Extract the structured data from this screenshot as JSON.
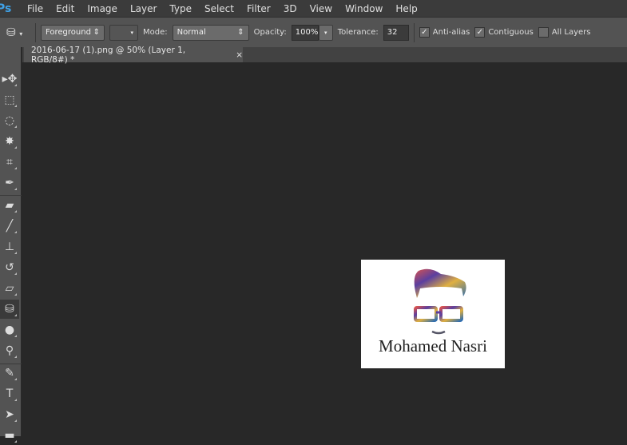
{
  "app": {
    "logo": "Ps"
  },
  "menu": [
    "File",
    "Edit",
    "Image",
    "Layer",
    "Type",
    "Select",
    "Filter",
    "3D",
    "View",
    "Window",
    "Help"
  ],
  "options": {
    "fill_source": "Foreground",
    "mode_label": "Mode:",
    "mode_value": "Normal",
    "opacity_label": "Opacity:",
    "opacity_value": "100%",
    "tolerance_label": "Tolerance:",
    "tolerance_value": "32",
    "anti_alias_label": "Anti-alias",
    "anti_alias_checked": true,
    "contiguous_label": "Contiguous",
    "contiguous_checked": true,
    "all_layers_label": "All Layers",
    "all_layers_checked": false
  },
  "document": {
    "tab_title": "2016-06-17 (1).png @ 50% (Layer 1, RGB/8#) *",
    "close": "×",
    "caption": "Mohamed Nasri"
  },
  "tools": [
    {
      "name": "move",
      "glyph": "▸✥"
    },
    {
      "name": "marquee",
      "glyph": "⬚"
    },
    {
      "name": "lasso",
      "glyph": "◌"
    },
    {
      "name": "magic-wand",
      "glyph": "✸"
    },
    {
      "name": "crop",
      "glyph": "⌗"
    },
    {
      "name": "eyedropper",
      "glyph": "✒"
    },
    {
      "name": "healing",
      "glyph": "▰"
    },
    {
      "name": "brush",
      "glyph": "╱"
    },
    {
      "name": "stamp",
      "glyph": "⊥"
    },
    {
      "name": "history-brush",
      "glyph": "↺"
    },
    {
      "name": "eraser",
      "glyph": "▱"
    },
    {
      "name": "paint-bucket",
      "glyph": "⛁"
    },
    {
      "name": "blur",
      "glyph": "●"
    },
    {
      "name": "dodge",
      "glyph": "⚲"
    },
    {
      "name": "pen",
      "glyph": "✎"
    },
    {
      "name": "type",
      "glyph": "T"
    },
    {
      "name": "path-select",
      "glyph": "➤"
    },
    {
      "name": "shape",
      "glyph": "▬"
    }
  ]
}
